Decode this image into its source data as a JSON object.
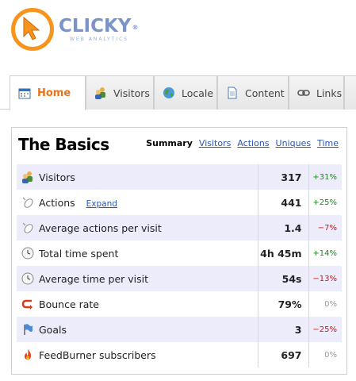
{
  "logo": {
    "wordmark": "CLICKY",
    "trademark": "®",
    "tagline": "WEB ANALYTICS"
  },
  "tabs": [
    {
      "label": "Home",
      "icon": "calendar-icon",
      "active": true
    },
    {
      "label": "Visitors",
      "icon": "users-icon"
    },
    {
      "label": "Locale",
      "icon": "globe-icon"
    },
    {
      "label": "Content",
      "icon": "document-icon"
    },
    {
      "label": "Links",
      "icon": "link-icon"
    }
  ],
  "panel": {
    "title": "The Basics",
    "links": {
      "summary": "Summary",
      "visitors": "Visitors",
      "actions": "Actions",
      "uniques": "Uniques",
      "time": "Time"
    }
  },
  "rows": [
    {
      "label": "Visitors",
      "value": "317",
      "change": "+31%",
      "trend": "up",
      "icon": "users-icon"
    },
    {
      "label": "Actions",
      "expand": "Expand",
      "value": "441",
      "change": "+25%",
      "trend": "up",
      "icon": "mouse-icon"
    },
    {
      "label": "Average actions per visit",
      "value": "1.4",
      "change": "−7%",
      "trend": "down",
      "icon": "mouse-icon"
    },
    {
      "label": "Total time spent",
      "value": "4h 45m",
      "change": "+14%",
      "trend": "up",
      "icon": "clock-icon"
    },
    {
      "label": "Average time per visit",
      "value": "54s",
      "change": "−13%",
      "trend": "down",
      "icon": "clock-icon"
    },
    {
      "label": "Bounce rate",
      "value": "79%",
      "change": "0%",
      "trend": "flat",
      "icon": "bounce-icon"
    },
    {
      "label": "Goals",
      "value": "3",
      "change": "−25%",
      "trend": "down",
      "icon": "flag-icon"
    },
    {
      "label": "FeedBurner subscribers",
      "value": "697",
      "change": "0%",
      "trend": "flat",
      "icon": "feedburner-icon"
    }
  ],
  "colors": {
    "accent": "#f7941d",
    "brand": "#7a93c9",
    "link": "#2a55b7",
    "positive": "#1a8a1a",
    "negative": "#d01515",
    "row_alt": "#ececfa"
  }
}
